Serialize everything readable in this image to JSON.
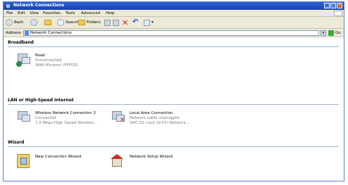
{
  "window": {
    "title": "Network Connections",
    "buttons": {
      "minimize": "_",
      "maximize": "□",
      "close": "X"
    }
  },
  "menu": [
    "File",
    "Edit",
    "View",
    "Favorites",
    "Tools",
    "Advanced",
    "Help"
  ],
  "toolbar": {
    "back_label": "Back",
    "search_label": "Search",
    "folders_label": "Folders"
  },
  "address": {
    "label": "Address",
    "value": "Network Connections",
    "go_label": "Go"
  },
  "groups": {
    "broadband": {
      "title": "Broadband",
      "items": [
        {
          "name": "Road",
          "status": "Disconnected",
          "device": "WAN Miniport (PPPOE)"
        }
      ]
    },
    "lan": {
      "title": "LAN or High-Speed Internet",
      "items": [
        {
          "name": "Wireless Network Connection 3",
          "status": "Connected",
          "device": "1.0 Mbps High Speed Wireless..."
        },
        {
          "name": "Local Area Connection",
          "status": "Network cable unplugged",
          "device": "SMC EZ Card 10 PCI Network..."
        }
      ]
    },
    "wizard": {
      "title": "Wizard",
      "items": [
        {
          "name": "New Connection Wizard"
        },
        {
          "name": "Network Setup Wizard"
        }
      ]
    }
  }
}
